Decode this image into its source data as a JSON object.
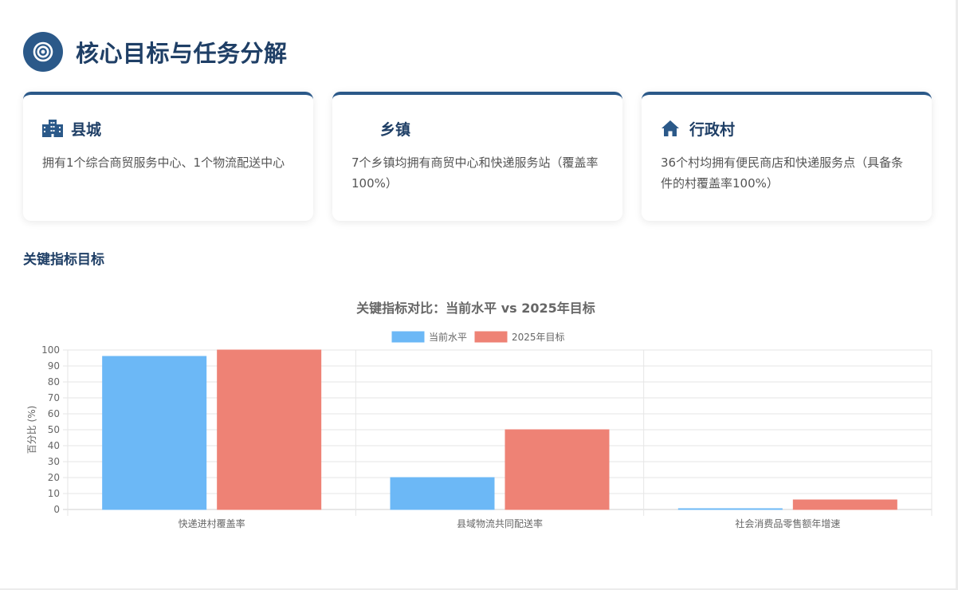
{
  "header": {
    "title": "核心目标与任务分解",
    "icon": "target-icon"
  },
  "cards": [
    {
      "icon": "building-icon",
      "title": "县城",
      "text": "拥有1个综合商贸服务中心、1个物流配送中心"
    },
    {
      "icon": "",
      "title": "乡镇",
      "text": "7个乡镇均拥有商贸中心和快递服务站（覆盖率100%）"
    },
    {
      "icon": "home-icon",
      "title": "行政村",
      "text": "36个村均拥有便民商店和快递服务点（具备条件的村覆盖率100%）"
    }
  ],
  "section": {
    "title": "关键指标目标"
  },
  "colors": {
    "primary": "#2b5989",
    "current": "#6cb8f6",
    "target": "#ee8275"
  },
  "chart_data": {
    "type": "bar",
    "title": "关键指标对比：当前水平 vs 2025年目标",
    "ylabel": "百分比 (%)",
    "xlabel": "",
    "ylim": [
      0,
      100
    ],
    "yticks": [
      0,
      10,
      20,
      30,
      40,
      50,
      60,
      70,
      80,
      90,
      100
    ],
    "grid": true,
    "legend_position": "top-center",
    "categories": [
      "快递进村覆盖率",
      "县域物流共同配送率",
      "社会消费品零售额年增速"
    ],
    "series": [
      {
        "name": "当前水平",
        "color": "#6cb8f6",
        "values": [
          96,
          20,
          0.5
        ]
      },
      {
        "name": "2025年目标",
        "color": "#ee8275",
        "values": [
          100,
          50,
          6
        ]
      }
    ]
  }
}
